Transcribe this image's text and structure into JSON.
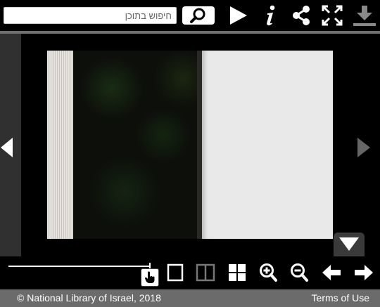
{
  "toolbar": {
    "search_placeholder": "חיפוש בתוכן",
    "icons": [
      "search-icon",
      "play-icon",
      "info-icon",
      "share-icon",
      "fullscreen-icon",
      "download-icon"
    ]
  },
  "viewer": {
    "nav_icons": [
      "prev-page-icon",
      "next-page-icon",
      "collapse-arrow-icon"
    ]
  },
  "bottom_bar": {
    "slider_position": 1.0,
    "icons": [
      "single-page-view-icon",
      "double-page-view-icon",
      "grid-view-icon",
      "zoom-in-icon",
      "zoom-out-icon",
      "arrow-left-icon",
      "arrow-right-icon"
    ]
  },
  "footer": {
    "copyright": "© National Library of Israel, 2018",
    "terms_link": "Terms of Use"
  },
  "colors": {
    "background": "#000000",
    "footer_bg": "#6b6b6b",
    "rail": "#303030",
    "icon": "#ffffff",
    "disabled_icon": "#8a8a8a"
  }
}
